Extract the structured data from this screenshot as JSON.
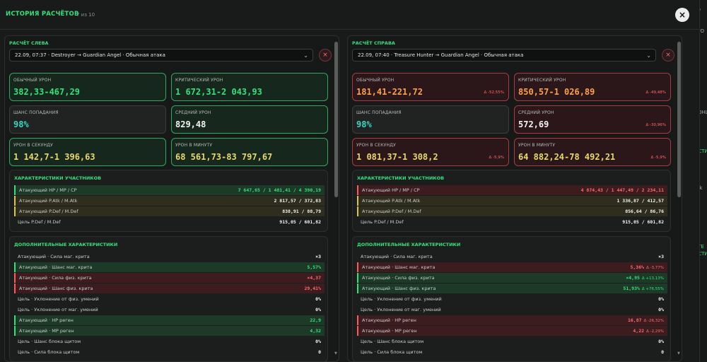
{
  "modal": {
    "title": "ИСТОРИЯ РАСЧЁТОВ",
    "counter": "7 из 10",
    "close_icon": "×"
  },
  "background_fragments": [
    "40",
    "УРО",
    "КОНЦ",
    "2",
    "ИСТИ",
    "Atk",
    "ИТЕ",
    "ИСТИ"
  ],
  "left": {
    "label": "РАСЧЁТ СЛЕВА",
    "select_value": "22.09, 07:37 · Destroyer → Guardian Angel · Обычная атака",
    "remove_icon": "×",
    "stats": [
      {
        "label": "ОБЫЧНЫЙ УРОН",
        "value": "382,33-467,29",
        "delta": ""
      },
      {
        "label": "КРИТИЧЕСКИЙ УРОН",
        "value": "1 672,31-2 043,93",
        "delta": ""
      },
      {
        "label": "ШАНС ПОПАДАНИЯ",
        "value": "98%",
        "delta": ""
      },
      {
        "label": "СРЕДНИЙ УРОН",
        "value": "829,48",
        "delta": ""
      },
      {
        "label": "УРОН В СЕКУНДУ",
        "value": "1 142,7-1 396,63",
        "delta": ""
      },
      {
        "label": "УРОН В МИНУТУ",
        "value": "68 561,73-83 797,67",
        "delta": ""
      }
    ],
    "participants": {
      "title": "ХАРАКТЕРИСТИКИ УЧАСТНИКОВ",
      "rows": [
        {
          "label": "Атакующий HP / MP / CP",
          "value": "7 647,65 / 1 481,41 / 4 390,19",
          "delta": ""
        },
        {
          "label": "Атакующий P.Atk / M.Atk",
          "value": "2 817,57 / 372,83",
          "delta": ""
        },
        {
          "label": "Атакующий P.Def / M.Def",
          "value": "838,91 / 88,79",
          "delta": ""
        },
        {
          "label": "Цель P.Def / M.Def",
          "value": "915,05 / 601,82",
          "delta": ""
        }
      ]
    },
    "extra": {
      "title": "ДОПОЛНИТЕЛЬНЫЕ ХАРАКТЕРИСТИКИ",
      "rows": [
        {
          "label": "Атакующий · Сила маг. крита",
          "value": "×3",
          "delta": ""
        },
        {
          "label": "Атакующий · Шанс маг. крита",
          "value": "5,57%",
          "delta": ""
        },
        {
          "label": "Атакующий · Сила физ. крита",
          "value": "×4,37",
          "delta": ""
        },
        {
          "label": "Атакующий · Шанс физ. крита",
          "value": "29,41%",
          "delta": ""
        },
        {
          "label": "Цель · Уклонение от физ. умений",
          "value": "0%",
          "delta": ""
        },
        {
          "label": "Цель · Уклонение от маг. умений",
          "value": "0%",
          "delta": ""
        },
        {
          "label": "Атакующий · HP реген",
          "value": "22,9",
          "delta": ""
        },
        {
          "label": "Атакующий · MP реген",
          "value": "4,32",
          "delta": ""
        },
        {
          "label": "Цель · Шанс блока щитом",
          "value": "0%",
          "delta": ""
        },
        {
          "label": "Цель · Сила блока щитом",
          "value": "0",
          "delta": ""
        }
      ]
    }
  },
  "right": {
    "label": "РАСЧЁТ СПРАВА",
    "select_value": "22.09, 07:40 · Treasure Hunter → Guardian Angel · Обычная атака",
    "remove_icon": "×",
    "stats": [
      {
        "label": "ОБЫЧНЫЙ УРОН",
        "value": "181,41-221,72",
        "delta": "Δ -52,55%"
      },
      {
        "label": "КРИТИЧЕСКИЙ УРОН",
        "value": "850,57-1 026,89",
        "delta": "Δ -49,48%"
      },
      {
        "label": "ШАНС ПОПАДАНИЯ",
        "value": "98%",
        "delta": ""
      },
      {
        "label": "СРЕДНИЙ УРОН",
        "value": "572,69",
        "delta": "Δ -30,96%"
      },
      {
        "label": "УРОН В СЕКУНДУ",
        "value": "1 081,37-1 308,2",
        "delta": "Δ -5,9%"
      },
      {
        "label": "УРОН В МИНУТУ",
        "value": "64 882,24-78 492,21",
        "delta": "Δ -5,9%"
      }
    ],
    "participants": {
      "title": "ХАРАКТЕРИСТИКИ УЧАСТНИКОВ",
      "rows": [
        {
          "label": "Атакующий HP / MP / CP",
          "value": "4 874,43 / 1 447,49 / 2 234,11",
          "delta": ""
        },
        {
          "label": "Атакующий P.Atk / M.Atk",
          "value": "1 336,87 / 412,57",
          "delta": ""
        },
        {
          "label": "Атакующий P.Def / M.Def",
          "value": "856,64 / 86,76",
          "delta": ""
        },
        {
          "label": "Цель P.Def / M.Def",
          "value": "915,05 / 601,82",
          "delta": ""
        }
      ]
    },
    "extra": {
      "title": "ДОПОЛНИТЕЛЬНЫЕ ХАРАКТЕРИСТИКИ",
      "rows": [
        {
          "label": "Атакующий · Сила маг. крита",
          "value": "×3",
          "delta": ""
        },
        {
          "label": "Атакующий · Шанс маг. крита",
          "value": "5,36%",
          "delta": "Δ -3,77%"
        },
        {
          "label": "Атакующий · Сила физ. крита",
          "value": "×4,95",
          "delta": "Δ +13,13%"
        },
        {
          "label": "Атакующий · Шанс физ. крита",
          "value": "51,93%",
          "delta": "Δ +76,55%"
        },
        {
          "label": "Цель · Уклонение от физ. умений",
          "value": "0%",
          "delta": ""
        },
        {
          "label": "Цель · Уклонение от маг. умений",
          "value": "0%",
          "delta": ""
        },
        {
          "label": "Атакующий · HP реген",
          "value": "16,87",
          "delta": "Δ -26,32%"
        },
        {
          "label": "Атакующий · MP реген",
          "value": "4,22",
          "delta": "Δ -2,29%"
        },
        {
          "label": "Цель · Шанс блока щитом",
          "value": "0%",
          "delta": ""
        },
        {
          "label": "Цель · Сила блока щитом",
          "value": "0",
          "delta": ""
        }
      ]
    }
  },
  "colors": {
    "accent": "#35e07a",
    "negative": "#ff6b6b",
    "orange": "#ffa04a",
    "teal": "#3ad6c2"
  }
}
